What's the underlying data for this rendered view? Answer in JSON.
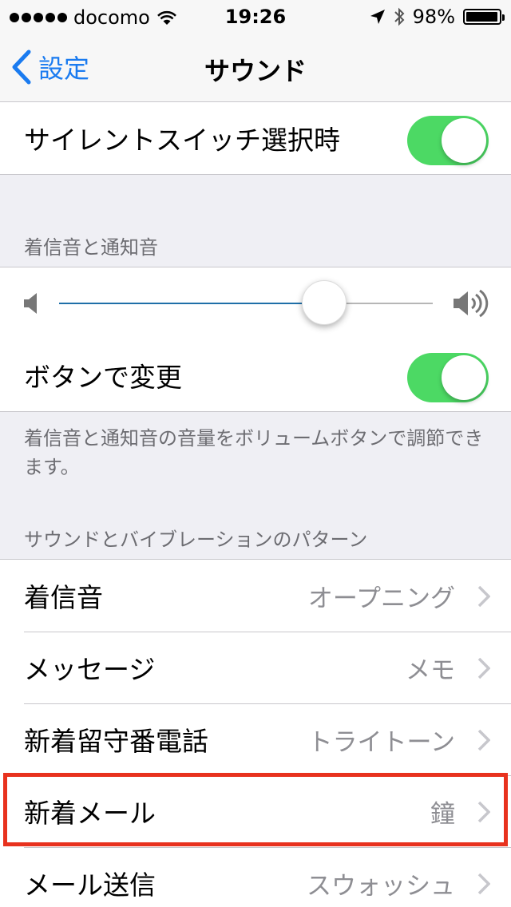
{
  "status": {
    "carrier": "docomo",
    "time": "19:26",
    "battery": "98%",
    "battery_level": 0.98
  },
  "nav": {
    "back_label": "設定",
    "title": "サウンド"
  },
  "silent": {
    "label": "サイレントスイッチ選択時",
    "on": true
  },
  "ringer": {
    "header": "着信音と通知音",
    "volume": 0.71,
    "change_with_buttons_label": "ボタンで変更",
    "change_with_buttons_on": true,
    "footer": "着信音と通知音の音量をボリュームボタンで調節できます。"
  },
  "patterns": {
    "header": "サウンドとバイブレーションのパターン",
    "items": [
      {
        "label": "着信音",
        "value": "オープニング"
      },
      {
        "label": "メッセージ",
        "value": "メモ"
      },
      {
        "label": "新着留守番電話",
        "value": "トライトーン"
      },
      {
        "label": "新着メール",
        "value": "鐘"
      },
      {
        "label": "メール送信",
        "value": "スウォッシュ"
      }
    ]
  },
  "colors": {
    "accent": "#1a7bf0",
    "toggle_on": "#4cd964",
    "highlight": "#e8321e"
  }
}
